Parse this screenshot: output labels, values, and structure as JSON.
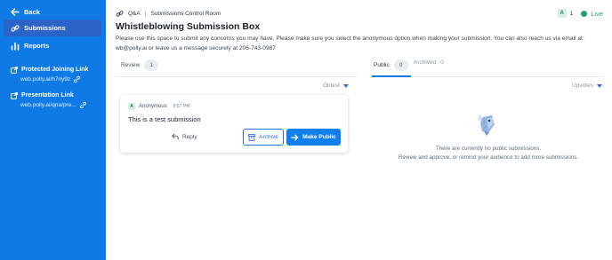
{
  "sidebar": {
    "back_label": "Back",
    "nav": [
      {
        "label": "Submissions",
        "icon": "link-chain-icon",
        "active": true
      },
      {
        "label": "Reports",
        "icon": "chart-icon",
        "active": false
      }
    ],
    "links": [
      {
        "title": "Protected Joining Link",
        "url": "web.polly.ai/h7ny9z"
      },
      {
        "title": "Presentation Link",
        "url": "web.polly.ai/qna/pre..."
      }
    ],
    "colors": {
      "background": "#0f7ae5",
      "active": "#2b63c9"
    }
  },
  "header": {
    "breadcrumb_app": "Q&A",
    "breadcrumb_page": "Submissions Control Room",
    "viewer_avatar": "A",
    "viewer_count": "1",
    "live_label": "Live",
    "title": "Whistleblowing Submission Box",
    "description": "Please use this space to submit any concerns you may have. Please make sure you select the anonymous option when making your submission. You can also reach us via email at: wb@polly.ai or leave us a message securely at 206-743-0987"
  },
  "review": {
    "tab_label": "Review",
    "count": "1",
    "sort_label": "Oldest",
    "submissions": [
      {
        "avatar": "A",
        "author": "Anonymous",
        "time": "9:57 PM",
        "text": "This is a test submission",
        "reply_label": "Reply",
        "archive_label": "Archive",
        "make_public_label": "Make Public"
      }
    ]
  },
  "public": {
    "tab_label": "Public",
    "count": "0",
    "archived_label": "Archived",
    "archived_count": "0",
    "sort_label": "Upvotes",
    "empty_line1": "There are currently no public submissions.",
    "empty_line2": "Review and approve, or remind your audience to add more submissions."
  },
  "colors": {
    "accent": "#0f7ae5",
    "live": "#21a366"
  }
}
